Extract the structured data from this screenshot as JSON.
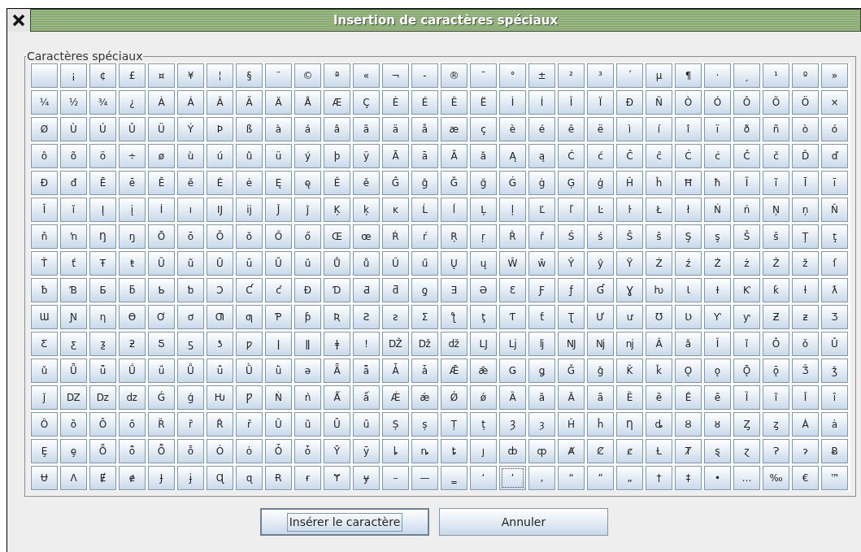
{
  "window": {
    "title": "Insertion de caractères spéciaux"
  },
  "group": {
    "label": "Caractères spéciaux"
  },
  "rows": [
    {
      "cells": [
        {
          "focused": false
        },
        {
          "char": "¡",
          "focused": false
        },
        {
          "char": "¢",
          "focused": false
        },
        {
          "char": "£",
          "focused": false
        },
        {
          "char": "¤",
          "focused": false
        },
        {
          "char": "¥",
          "focused": false
        },
        {
          "char": "¦",
          "focused": false
        },
        {
          "char": "§",
          "focused": false
        },
        {
          "char": "¨",
          "focused": false
        },
        {
          "char": "©",
          "focused": false
        },
        {
          "char": "ª",
          "focused": false
        },
        {
          "char": "«",
          "focused": false
        },
        {
          "char": "¬",
          "focused": false
        },
        {
          "char": "-",
          "focused": false
        },
        {
          "char": "®",
          "focused": false
        },
        {
          "char": "¯",
          "focused": false
        },
        {
          "char": "°",
          "focused": false
        },
        {
          "char": "±",
          "focused": false
        },
        {
          "char": "²",
          "focused": false
        },
        {
          "char": "³",
          "focused": false
        },
        {
          "char": "´",
          "focused": false
        },
        {
          "char": "µ",
          "focused": false
        },
        {
          "char": "¶",
          "focused": false
        },
        {
          "char": "·",
          "focused": false
        },
        {
          "char": "¸",
          "focused": false
        },
        {
          "char": "¹",
          "focused": false
        },
        {
          "char": "º",
          "focused": false
        },
        {
          "char": "»",
          "focused": false
        }
      ]
    },
    {
      "cells": [
        {
          "char": "¼",
          "focused": false
        },
        {
          "char": "½",
          "focused": false
        },
        {
          "char": "¾",
          "focused": false
        },
        {
          "char": "¿",
          "focused": false
        },
        {
          "char": "À",
          "focused": false
        },
        {
          "char": "Á",
          "focused": false
        },
        {
          "char": "Â",
          "focused": false
        },
        {
          "char": "Ã",
          "focused": false
        },
        {
          "char": "Ä",
          "focused": false
        },
        {
          "char": "Å",
          "focused": false
        },
        {
          "char": "Æ",
          "focused": false
        },
        {
          "char": "Ç",
          "focused": false
        },
        {
          "char": "È",
          "focused": false
        },
        {
          "char": "É",
          "focused": false
        },
        {
          "char": "Ê",
          "focused": false
        },
        {
          "char": "Ë",
          "focused": false
        },
        {
          "char": "Ì",
          "focused": false
        },
        {
          "char": "Í",
          "focused": false
        },
        {
          "char": "Î",
          "focused": false
        },
        {
          "char": "Ï",
          "focused": false
        },
        {
          "char": "Ð",
          "focused": false
        },
        {
          "char": "Ñ",
          "focused": false
        },
        {
          "char": "Ò",
          "focused": false
        },
        {
          "char": "Ó",
          "focused": false
        },
        {
          "char": "Ô",
          "focused": false
        },
        {
          "char": "Õ",
          "focused": false
        },
        {
          "char": "Ö",
          "focused": false
        },
        {
          "char": "×",
          "focused": false
        }
      ]
    },
    {
      "cells": [
        {
          "char": "Ø",
          "focused": false
        },
        {
          "char": "Ù",
          "focused": false
        },
        {
          "char": "Ú",
          "focused": false
        },
        {
          "char": "Û",
          "focused": false
        },
        {
          "char": "Ü",
          "focused": false
        },
        {
          "char": "Ý",
          "focused": false
        },
        {
          "char": "Þ",
          "focused": false
        },
        {
          "char": "ß",
          "focused": false
        },
        {
          "char": "à",
          "focused": false
        },
        {
          "char": "á",
          "focused": false
        },
        {
          "char": "â",
          "focused": false
        },
        {
          "char": "ã",
          "focused": false
        },
        {
          "char": "ä",
          "focused": false
        },
        {
          "char": "å",
          "focused": false
        },
        {
          "char": "æ",
          "focused": false
        },
        {
          "char": "ç",
          "focused": false
        },
        {
          "char": "è",
          "focused": false
        },
        {
          "char": "é",
          "focused": false
        },
        {
          "char": "ê",
          "focused": false
        },
        {
          "char": "ë",
          "focused": false
        },
        {
          "char": "ì",
          "focused": false
        },
        {
          "char": "í",
          "focused": false
        },
        {
          "char": "î",
          "focused": false
        },
        {
          "char": "ï",
          "focused": false
        },
        {
          "char": "ð",
          "focused": false
        },
        {
          "char": "ñ",
          "focused": false
        },
        {
          "char": "ò",
          "focused": false
        },
        {
          "char": "ó",
          "focused": false
        }
      ]
    },
    {
      "cells": [
        {
          "char": "ô",
          "focused": false
        },
        {
          "char": "õ",
          "focused": false
        },
        {
          "char": "ö",
          "focused": false
        },
        {
          "char": "÷",
          "focused": false
        },
        {
          "char": "ø",
          "focused": false
        },
        {
          "char": "ù",
          "focused": false
        },
        {
          "char": "ú",
          "focused": false
        },
        {
          "char": "û",
          "focused": false
        },
        {
          "char": "ü",
          "focused": false
        },
        {
          "char": "ý",
          "focused": false
        },
        {
          "char": "þ",
          "focused": false
        },
        {
          "char": "ÿ",
          "focused": false
        },
        {
          "char": "Ā",
          "focused": false
        },
        {
          "char": "ā",
          "focused": false
        },
        {
          "char": "Ă",
          "focused": false
        },
        {
          "char": "ă",
          "focused": false
        },
        {
          "char": "Ą",
          "focused": false
        },
        {
          "char": "ą",
          "focused": false
        },
        {
          "char": "Ć",
          "focused": false
        },
        {
          "char": "ć",
          "focused": false
        },
        {
          "char": "Ĉ",
          "focused": false
        },
        {
          "char": "ĉ",
          "focused": false
        },
        {
          "char": "Ċ",
          "focused": false
        },
        {
          "char": "ċ",
          "focused": false
        },
        {
          "char": "Č",
          "focused": false
        },
        {
          "char": "č",
          "focused": false
        },
        {
          "char": "Ď",
          "focused": false
        },
        {
          "char": "ď",
          "focused": false
        }
      ]
    },
    {
      "cells": [
        {
          "char": "Đ",
          "focused": false
        },
        {
          "char": "đ",
          "focused": false
        },
        {
          "char": "Ē",
          "focused": false
        },
        {
          "char": "ē",
          "focused": false
        },
        {
          "char": "Ĕ",
          "focused": false
        },
        {
          "char": "ĕ",
          "focused": false
        },
        {
          "char": "Ė",
          "focused": false
        },
        {
          "char": "ė",
          "focused": false
        },
        {
          "char": "Ę",
          "focused": false
        },
        {
          "char": "ę",
          "focused": false
        },
        {
          "char": "Ě",
          "focused": false
        },
        {
          "char": "ě",
          "focused": false
        },
        {
          "char": "Ĝ",
          "focused": false
        },
        {
          "char": "ĝ",
          "focused": false
        },
        {
          "char": "Ğ",
          "focused": false
        },
        {
          "char": "ğ",
          "focused": false
        },
        {
          "char": "Ġ",
          "focused": false
        },
        {
          "char": "ġ",
          "focused": false
        },
        {
          "char": "Ģ",
          "focused": false
        },
        {
          "char": "ģ",
          "focused": false
        },
        {
          "char": "Ĥ",
          "focused": false
        },
        {
          "char": "ĥ",
          "focused": false
        },
        {
          "char": "Ħ",
          "focused": false
        },
        {
          "char": "ħ",
          "focused": false
        },
        {
          "char": "Ĩ",
          "focused": false
        },
        {
          "char": "ĩ",
          "focused": false
        },
        {
          "char": "Ī",
          "focused": false
        },
        {
          "char": "ī",
          "focused": false
        }
      ]
    },
    {
      "cells": [
        {
          "char": "Ĭ",
          "focused": false
        },
        {
          "char": "ĭ",
          "focused": false
        },
        {
          "char": "Į",
          "focused": false
        },
        {
          "char": "į",
          "focused": false
        },
        {
          "char": "İ",
          "focused": false
        },
        {
          "char": "ı",
          "focused": false
        },
        {
          "char": "Ĳ",
          "focused": false
        },
        {
          "char": "ĳ",
          "focused": false
        },
        {
          "char": "Ĵ",
          "focused": false
        },
        {
          "char": "ĵ",
          "focused": false
        },
        {
          "char": "Ķ",
          "focused": false
        },
        {
          "char": "ķ",
          "focused": false
        },
        {
          "char": "ĸ",
          "focused": false
        },
        {
          "char": "Ĺ",
          "focused": false
        },
        {
          "char": "ĺ",
          "focused": false
        },
        {
          "char": "Ļ",
          "focused": false
        },
        {
          "char": "ļ",
          "focused": false
        },
        {
          "char": "Ľ",
          "focused": false
        },
        {
          "char": "ľ",
          "focused": false
        },
        {
          "char": "Ŀ",
          "focused": false
        },
        {
          "char": "ŀ",
          "focused": false
        },
        {
          "char": "Ł",
          "focused": false
        },
        {
          "char": "ł",
          "focused": false
        },
        {
          "char": "Ń",
          "focused": false
        },
        {
          "char": "ń",
          "focused": false
        },
        {
          "char": "Ņ",
          "focused": false
        },
        {
          "char": "ņ",
          "focused": false
        },
        {
          "char": "Ň",
          "focused": false
        }
      ]
    },
    {
      "cells": [
        {
          "char": "ň",
          "focused": false
        },
        {
          "char": "ŉ",
          "focused": false
        },
        {
          "char": "Ŋ",
          "focused": false
        },
        {
          "char": "ŋ",
          "focused": false
        },
        {
          "char": "Ō",
          "focused": false
        },
        {
          "char": "ō",
          "focused": false
        },
        {
          "char": "Ŏ",
          "focused": false
        },
        {
          "char": "ŏ",
          "focused": false
        },
        {
          "char": "Ő",
          "focused": false
        },
        {
          "char": "ő",
          "focused": false
        },
        {
          "char": "Œ",
          "focused": false
        },
        {
          "char": "œ",
          "focused": false
        },
        {
          "char": "Ŕ",
          "focused": false
        },
        {
          "char": "ŕ",
          "focused": false
        },
        {
          "char": "Ŗ",
          "focused": false
        },
        {
          "char": "ŗ",
          "focused": false
        },
        {
          "char": "Ř",
          "focused": false
        },
        {
          "char": "ř",
          "focused": false
        },
        {
          "char": "Ś",
          "focused": false
        },
        {
          "char": "ś",
          "focused": false
        },
        {
          "char": "Ŝ",
          "focused": false
        },
        {
          "char": "ŝ",
          "focused": false
        },
        {
          "char": "Ş",
          "focused": false
        },
        {
          "char": "ş",
          "focused": false
        },
        {
          "char": "Š",
          "focused": false
        },
        {
          "char": "š",
          "focused": false
        },
        {
          "char": "Ţ",
          "focused": false
        },
        {
          "char": "ţ",
          "focused": false
        }
      ]
    },
    {
      "cells": [
        {
          "char": "Ť",
          "focused": false
        },
        {
          "char": "ť",
          "focused": false
        },
        {
          "char": "Ŧ",
          "focused": false
        },
        {
          "char": "ŧ",
          "focused": false
        },
        {
          "char": "Ũ",
          "focused": false
        },
        {
          "char": "ũ",
          "focused": false
        },
        {
          "char": "Ū",
          "focused": false
        },
        {
          "char": "ū",
          "focused": false
        },
        {
          "char": "Ŭ",
          "focused": false
        },
        {
          "char": "ŭ",
          "focused": false
        },
        {
          "char": "Ů",
          "focused": false
        },
        {
          "char": "ů",
          "focused": false
        },
        {
          "char": "Ű",
          "focused": false
        },
        {
          "char": "ű",
          "focused": false
        },
        {
          "char": "Ų",
          "focused": false
        },
        {
          "char": "ų",
          "focused": false
        },
        {
          "char": "Ŵ",
          "focused": false
        },
        {
          "char": "ŵ",
          "focused": false
        },
        {
          "char": "Ŷ",
          "focused": false
        },
        {
          "char": "ŷ",
          "focused": false
        },
        {
          "char": "Ÿ",
          "focused": false
        },
        {
          "char": "Ź",
          "focused": false
        },
        {
          "char": "ź",
          "focused": false
        },
        {
          "char": "Ż",
          "focused": false
        },
        {
          "char": "ż",
          "focused": false
        },
        {
          "char": "Ž",
          "focused": false
        },
        {
          "char": "ž",
          "focused": false
        },
        {
          "char": "ſ",
          "focused": false
        }
      ]
    },
    {
      "cells": [
        {
          "char": "ƀ",
          "focused": false
        },
        {
          "char": "Ɓ",
          "focused": false
        },
        {
          "char": "Ƃ",
          "focused": false
        },
        {
          "char": "ƃ",
          "focused": false
        },
        {
          "char": "Ƅ",
          "focused": false
        },
        {
          "char": "ƅ",
          "focused": false
        },
        {
          "char": "Ɔ",
          "focused": false
        },
        {
          "char": "Ƈ",
          "focused": false
        },
        {
          "char": "ƈ",
          "focused": false
        },
        {
          "char": "Ɖ",
          "focused": false
        },
        {
          "char": "Ɗ",
          "focused": false
        },
        {
          "char": "Ƌ",
          "focused": false
        },
        {
          "char": "ƌ",
          "focused": false
        },
        {
          "char": "ƍ",
          "focused": false
        },
        {
          "char": "Ǝ",
          "focused": false
        },
        {
          "char": "Ə",
          "focused": false
        },
        {
          "char": "Ɛ",
          "focused": false
        },
        {
          "char": "Ƒ",
          "focused": false
        },
        {
          "char": "ƒ",
          "focused": false
        },
        {
          "char": "Ɠ",
          "focused": false
        },
        {
          "char": "Ɣ",
          "focused": false
        },
        {
          "char": "ƕ",
          "focused": false
        },
        {
          "char": "Ɩ",
          "focused": false
        },
        {
          "char": "Ɨ",
          "focused": false
        },
        {
          "char": "Ƙ",
          "focused": false
        },
        {
          "char": "ƙ",
          "focused": false
        },
        {
          "char": "ƚ",
          "focused": false
        },
        {
          "char": "ƛ",
          "focused": false
        }
      ]
    },
    {
      "cells": [
        {
          "char": "Ɯ",
          "focused": false
        },
        {
          "char": "Ɲ",
          "focused": false
        },
        {
          "char": "ƞ",
          "focused": false
        },
        {
          "char": "Ɵ",
          "focused": false
        },
        {
          "char": "Ơ",
          "focused": false
        },
        {
          "char": "ơ",
          "focused": false
        },
        {
          "char": "Ƣ",
          "focused": false
        },
        {
          "char": "ƣ",
          "focused": false
        },
        {
          "char": "Ƥ",
          "focused": false
        },
        {
          "char": "ƥ",
          "focused": false
        },
        {
          "char": "Ʀ",
          "focused": false
        },
        {
          "char": "Ƨ",
          "focused": false
        },
        {
          "char": "ƨ",
          "focused": false
        },
        {
          "char": "Ʃ",
          "focused": false
        },
        {
          "char": "ƪ",
          "focused": false
        },
        {
          "char": "ƫ",
          "focused": false
        },
        {
          "char": "Ƭ",
          "focused": false
        },
        {
          "char": "ƭ",
          "focused": false
        },
        {
          "char": "Ʈ",
          "focused": false
        },
        {
          "char": "Ư",
          "focused": false
        },
        {
          "char": "ư",
          "focused": false
        },
        {
          "char": "Ʊ",
          "focused": false
        },
        {
          "char": "Ʋ",
          "focused": false
        },
        {
          "char": "Ƴ",
          "focused": false
        },
        {
          "char": "ƴ",
          "focused": false
        },
        {
          "char": "Ƶ",
          "focused": false
        },
        {
          "char": "ƶ",
          "focused": false
        },
        {
          "char": "Ʒ",
          "focused": false
        }
      ]
    },
    {
      "cells": [
        {
          "char": "Ƹ",
          "focused": false
        },
        {
          "char": "ƹ",
          "focused": false
        },
        {
          "char": "ƺ",
          "focused": false
        },
        {
          "char": "ƻ",
          "focused": false
        },
        {
          "char": "Ƽ",
          "focused": false
        },
        {
          "char": "ƽ",
          "focused": false
        },
        {
          "char": "ƾ",
          "focused": false
        },
        {
          "char": "ƿ",
          "focused": false
        },
        {
          "char": "ǀ",
          "focused": false
        },
        {
          "char": "ǁ",
          "focused": false
        },
        {
          "char": "ǂ",
          "focused": false
        },
        {
          "char": "ǃ",
          "focused": false
        },
        {
          "char": "Ǆ",
          "focused": false
        },
        {
          "char": "ǅ",
          "focused": false
        },
        {
          "char": "ǆ",
          "focused": false
        },
        {
          "char": "Ǉ",
          "focused": false
        },
        {
          "char": "ǈ",
          "focused": false
        },
        {
          "char": "ǉ",
          "focused": false
        },
        {
          "char": "Ǌ",
          "focused": false
        },
        {
          "char": "ǋ",
          "focused": false
        },
        {
          "char": "ǌ",
          "focused": false
        },
        {
          "char": "Ǎ",
          "focused": false
        },
        {
          "char": "ǎ",
          "focused": false
        },
        {
          "char": "Ǐ",
          "focused": false
        },
        {
          "char": "ǐ",
          "focused": false
        },
        {
          "char": "Ǒ",
          "focused": false
        },
        {
          "char": "ǒ",
          "focused": false
        },
        {
          "char": "Ǔ",
          "focused": false
        }
      ]
    },
    {
      "cells": [
        {
          "char": "ǔ",
          "focused": false
        },
        {
          "char": "Ǖ",
          "focused": false
        },
        {
          "char": "ǖ",
          "focused": false
        },
        {
          "char": "Ǘ",
          "focused": false
        },
        {
          "char": "ǘ",
          "focused": false
        },
        {
          "char": "Ǚ",
          "focused": false
        },
        {
          "char": "ǚ",
          "focused": false
        },
        {
          "char": "Ǜ",
          "focused": false
        },
        {
          "char": "ǜ",
          "focused": false
        },
        {
          "char": "ǝ",
          "focused": false
        },
        {
          "char": "Ǟ",
          "focused": false
        },
        {
          "char": "ǟ",
          "focused": false
        },
        {
          "char": "Ǡ",
          "focused": false
        },
        {
          "char": "ǡ",
          "focused": false
        },
        {
          "char": "Ǣ",
          "focused": false
        },
        {
          "char": "ǣ",
          "focused": false
        },
        {
          "char": "Ǥ",
          "focused": false
        },
        {
          "char": "ǥ",
          "focused": false
        },
        {
          "char": "Ǧ",
          "focused": false
        },
        {
          "char": "ǧ",
          "focused": false
        },
        {
          "char": "Ǩ",
          "focused": false
        },
        {
          "char": "ǩ",
          "focused": false
        },
        {
          "char": "Ǫ",
          "focused": false
        },
        {
          "char": "ǫ",
          "focused": false
        },
        {
          "char": "Ǭ",
          "focused": false
        },
        {
          "char": "ǭ",
          "focused": false
        },
        {
          "char": "Ǯ",
          "focused": false
        },
        {
          "char": "ǯ",
          "focused": false
        }
      ]
    },
    {
      "cells": [
        {
          "char": "ǰ",
          "focused": false
        },
        {
          "char": "Ǳ",
          "focused": false
        },
        {
          "char": "ǲ",
          "focused": false
        },
        {
          "char": "ǳ",
          "focused": false
        },
        {
          "char": "Ǵ",
          "focused": false
        },
        {
          "char": "ǵ",
          "focused": false
        },
        {
          "char": "Ƕ",
          "focused": false
        },
        {
          "char": "Ƿ",
          "focused": false
        },
        {
          "char": "Ǹ",
          "focused": false
        },
        {
          "char": "ǹ",
          "focused": false
        },
        {
          "char": "Ǻ",
          "focused": false
        },
        {
          "char": "ǻ",
          "focused": false
        },
        {
          "char": "Ǽ",
          "focused": false
        },
        {
          "char": "ǽ",
          "focused": false
        },
        {
          "char": "Ǿ",
          "focused": false
        },
        {
          "char": "ǿ",
          "focused": false
        },
        {
          "char": "Ȁ",
          "focused": false
        },
        {
          "char": "ȁ",
          "focused": false
        },
        {
          "char": "Ȃ",
          "focused": false
        },
        {
          "char": "ȃ",
          "focused": false
        },
        {
          "char": "Ȅ",
          "focused": false
        },
        {
          "char": "ȅ",
          "focused": false
        },
        {
          "char": "Ȇ",
          "focused": false
        },
        {
          "char": "ȇ",
          "focused": false
        },
        {
          "char": "Ȉ",
          "focused": false
        },
        {
          "char": "ȉ",
          "focused": false
        },
        {
          "char": "Ȋ",
          "focused": false
        },
        {
          "char": "ȋ",
          "focused": false
        }
      ]
    },
    {
      "cells": [
        {
          "char": "Ȍ",
          "focused": false
        },
        {
          "char": "ȍ",
          "focused": false
        },
        {
          "char": "Ȏ",
          "focused": false
        },
        {
          "char": "ȏ",
          "focused": false
        },
        {
          "char": "Ȑ",
          "focused": false
        },
        {
          "char": "ȑ",
          "focused": false
        },
        {
          "char": "Ȓ",
          "focused": false
        },
        {
          "char": "ȓ",
          "focused": false
        },
        {
          "char": "Ȕ",
          "focused": false
        },
        {
          "char": "ȕ",
          "focused": false
        },
        {
          "char": "Ȗ",
          "focused": false
        },
        {
          "char": "ȗ",
          "focused": false
        },
        {
          "char": "Ș",
          "focused": false
        },
        {
          "char": "ș",
          "focused": false
        },
        {
          "char": "Ț",
          "focused": false
        },
        {
          "char": "ț",
          "focused": false
        },
        {
          "char": "Ȝ",
          "focused": false
        },
        {
          "char": "ȝ",
          "focused": false
        },
        {
          "char": "Ȟ",
          "focused": false
        },
        {
          "char": "ȟ",
          "focused": false
        },
        {
          "char": "Ƞ",
          "focused": false
        },
        {
          "char": "ȡ",
          "focused": false
        },
        {
          "char": "Ȣ",
          "focused": false
        },
        {
          "char": "ȣ",
          "focused": false
        },
        {
          "char": "Ȥ",
          "focused": false
        },
        {
          "char": "ȥ",
          "focused": false
        },
        {
          "char": "Ȧ",
          "focused": false
        },
        {
          "char": "ȧ",
          "focused": false
        }
      ]
    },
    {
      "cells": [
        {
          "char": "Ȩ",
          "focused": false
        },
        {
          "char": "ȩ",
          "focused": false
        },
        {
          "char": "Ȫ",
          "focused": false
        },
        {
          "char": "ȫ",
          "focused": false
        },
        {
          "char": "Ȭ",
          "focused": false
        },
        {
          "char": "ȭ",
          "focused": false
        },
        {
          "char": "Ȯ",
          "focused": false
        },
        {
          "char": "ȯ",
          "focused": false
        },
        {
          "char": "Ȱ",
          "focused": false
        },
        {
          "char": "ȱ",
          "focused": false
        },
        {
          "char": "Ȳ",
          "focused": false
        },
        {
          "char": "ȳ",
          "focused": false
        },
        {
          "char": "ȴ",
          "focused": false
        },
        {
          "char": "ȵ",
          "focused": false
        },
        {
          "char": "ȶ",
          "focused": false
        },
        {
          "char": "ȷ",
          "focused": false
        },
        {
          "char": "ȸ",
          "focused": false
        },
        {
          "char": "ȹ",
          "focused": false
        },
        {
          "char": "Ⱥ",
          "focused": false
        },
        {
          "char": "Ȼ",
          "focused": false
        },
        {
          "char": "ȼ",
          "focused": false
        },
        {
          "char": "Ƚ",
          "focused": false
        },
        {
          "char": "Ⱦ",
          "focused": false
        },
        {
          "char": "ȿ",
          "focused": false
        },
        {
          "char": "ɀ",
          "focused": false
        },
        {
          "char": "Ɂ",
          "focused": false
        },
        {
          "char": "ɂ",
          "focused": false
        },
        {
          "char": "Ƀ",
          "focused": false
        }
      ]
    },
    {
      "cells": [
        {
          "char": "Ʉ",
          "focused": false
        },
        {
          "char": "Ʌ",
          "focused": false
        },
        {
          "char": "Ɇ",
          "focused": false
        },
        {
          "char": "ɇ",
          "focused": false
        },
        {
          "char": "Ɉ",
          "focused": false
        },
        {
          "char": "ɉ",
          "focused": false
        },
        {
          "char": "Ɋ",
          "focused": false
        },
        {
          "char": "ɋ",
          "focused": false
        },
        {
          "char": "Ɍ",
          "focused": false
        },
        {
          "char": "ɍ",
          "focused": false
        },
        {
          "char": "Ɏ",
          "focused": false
        },
        {
          "char": "ɏ",
          "focused": false
        },
        {
          "char": "–",
          "focused": false
        },
        {
          "char": "—",
          "focused": false
        },
        {
          "char": "‗",
          "focused": false
        },
        {
          "char": "‘",
          "focused": false
        },
        {
          "char": "’",
          "focused": true
        },
        {
          "char": "‚",
          "focused": false
        },
        {
          "char": "“",
          "focused": false
        },
        {
          "char": "”",
          "focused": false
        },
        {
          "char": "„",
          "focused": false
        },
        {
          "char": "†",
          "focused": false
        },
        {
          "char": "‡",
          "focused": false
        },
        {
          "char": "•",
          "focused": false
        },
        {
          "char": "…",
          "focused": false
        },
        {
          "char": "‰",
          "focused": false
        },
        {
          "char": "€",
          "focused": false
        },
        {
          "char": "™",
          "focused": false
        }
      ]
    }
  ],
  "buttons": [
    {
      "label": "Insérer le caractère",
      "focused": true
    },
    {
      "label": "Annuler",
      "focused": false
    }
  ]
}
